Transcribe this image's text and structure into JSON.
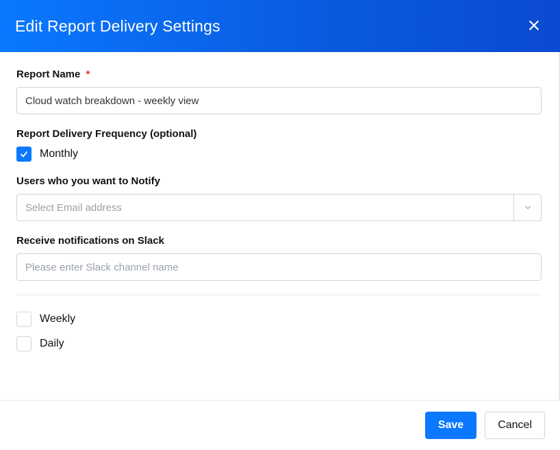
{
  "dialog": {
    "title": "Edit Report Delivery Settings"
  },
  "form": {
    "report_name": {
      "label": "Report Name",
      "required_marker": "*",
      "value": "Cloud watch breakdown - weekly view"
    },
    "frequency": {
      "label": "Report Delivery Frequency (optional)",
      "option_monthly": {
        "label": "Monthly",
        "checked": true
      }
    },
    "notify_users": {
      "label": "Users who you want to Notify",
      "placeholder": "Select Email address"
    },
    "slack": {
      "label": "Receive notifications on Slack",
      "placeholder": "Please enter Slack channel name",
      "value": ""
    },
    "extra_options": {
      "weekly": {
        "label": "Weekly",
        "checked": false
      },
      "daily": {
        "label": "Daily",
        "checked": false
      }
    }
  },
  "footer": {
    "save": "Save",
    "cancel": "Cancel"
  }
}
